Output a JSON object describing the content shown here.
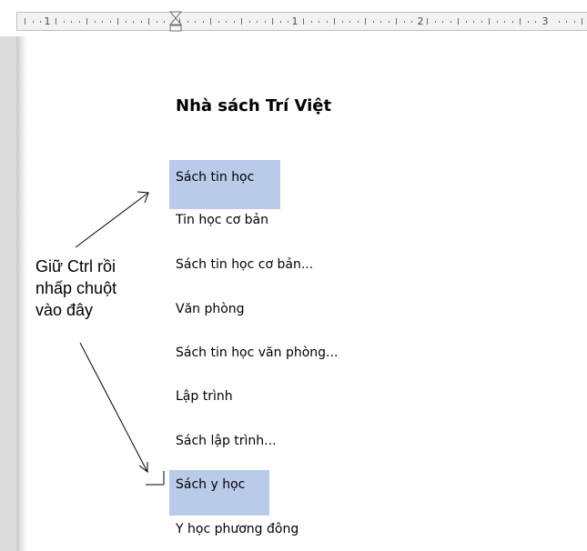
{
  "ruler": {
    "labels": [
      "1",
      "1",
      "2",
      "3"
    ]
  },
  "document": {
    "title": "Nhà sách Trí Việt",
    "lines": [
      "Sách tin học",
      "Tin học cơ bản",
      "Sách tin học cơ bản...",
      "Văn phòng",
      "Sách tin học văn phòng...",
      "Lập trình",
      "Sách lập trình...",
      "Sách y học",
      "Y học phương đông"
    ],
    "selected_lines": [
      "Sách tin học",
      "Sách y học"
    ]
  },
  "callout": {
    "lines": [
      "Giữ Ctrl rồi",
      "nhấp chuột",
      "vào đây"
    ]
  },
  "colors": {
    "selection": "#b9cbe8",
    "ruler_bg": "#f2f2f2",
    "text": "#000000"
  }
}
